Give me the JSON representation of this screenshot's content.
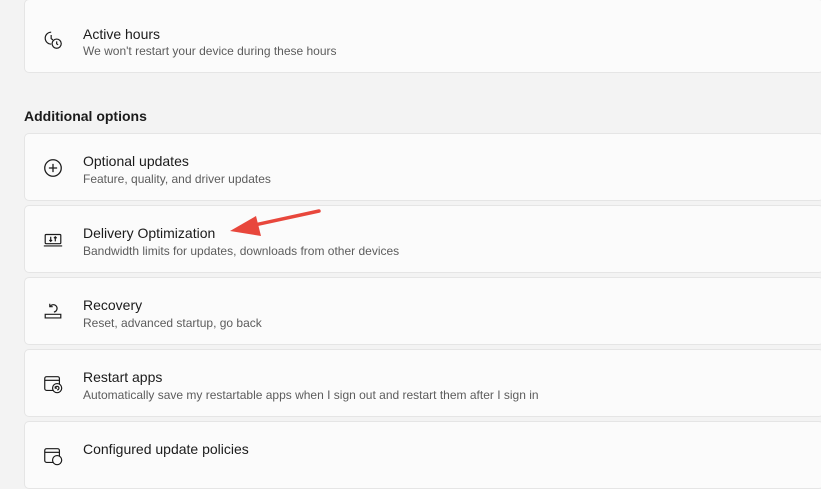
{
  "cards": {
    "active_hours": {
      "title": "Active hours",
      "description": "We won't restart your device during these hours",
      "icon": "active-hours-icon"
    },
    "optional_updates": {
      "title": "Optional updates",
      "description": "Feature, quality, and driver updates",
      "icon": "plus-circle-icon"
    },
    "delivery_optimization": {
      "title": "Delivery Optimization",
      "description": "Bandwidth limits for updates, downloads from other devices",
      "icon": "delivery-optimization-icon"
    },
    "recovery": {
      "title": "Recovery",
      "description": "Reset, advanced startup, go back",
      "icon": "recovery-icon"
    },
    "restart_apps": {
      "title": "Restart apps",
      "description": "Automatically save my restartable apps when I sign out and restart them after I sign in",
      "icon": "restart-apps-icon"
    },
    "configured_update_policies": {
      "title": "Configured update policies",
      "icon": "update-policies-icon"
    }
  },
  "section": {
    "additional_options": "Additional options"
  },
  "annotation": {
    "arrow_color": "#e8473c",
    "target": "Delivery Optimization"
  }
}
